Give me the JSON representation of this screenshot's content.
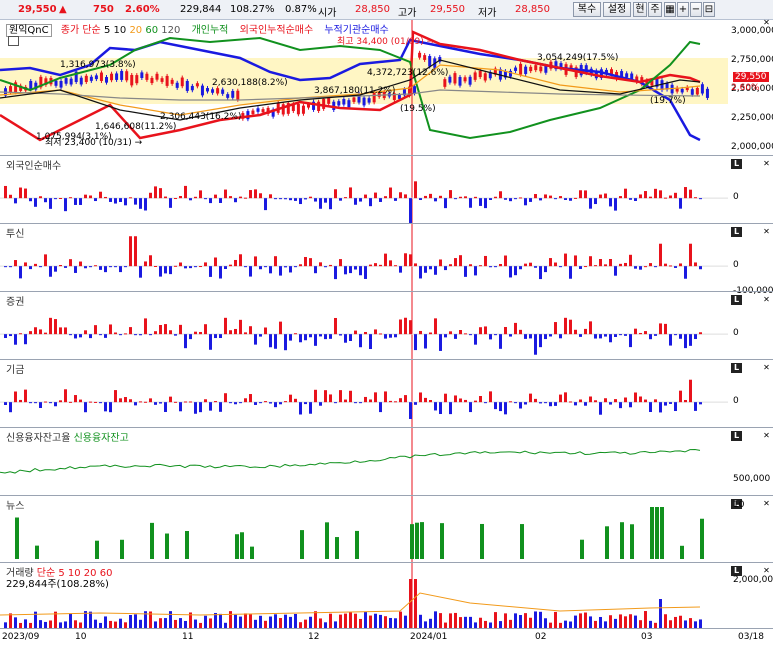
{
  "quote": {
    "price": "29,550",
    "arrow": "▲",
    "change": "750",
    "change_pct": "2.60%",
    "volume": "229,844",
    "vol_ratio": "108.27%",
    "turnover": "0.87%",
    "open_label": "시가",
    "open": "28,850",
    "high_label": "고가",
    "high": "29,550",
    "low_label": "저가",
    "low": "28,850"
  },
  "toolbar": {
    "restore": "복수",
    "settings": "설정",
    "current": "현",
    "week": "주"
  },
  "colors": {
    "red": "#e8131c",
    "blue": "#1a1ae0",
    "green": "#11911e",
    "orange": "#f29a1a",
    "black": "#111111",
    "band": "#fff6c4",
    "gray": "#888888"
  },
  "main_panel": {
    "symbol": "원익QnC",
    "legend": [
      {
        "label": "종가 단순",
        "color": "#e8131c"
      },
      {
        "label": "5",
        "color": "#000000"
      },
      {
        "label": "10",
        "color": "#000000"
      },
      {
        "label": "20",
        "color": "#000000"
      },
      {
        "label": "60",
        "color": "#11911e"
      },
      {
        "label": "120",
        "color": "#000000"
      },
      {
        "label": "개인누적",
        "color": "#11911e"
      },
      {
        "label": "외국인누적순매수",
        "color": "#e8131c"
      },
      {
        "label": "누적기관순매수",
        "color": "#1a1ae0"
      }
    ],
    "y_ticks": [
      "3,000,000",
      "2,750,000",
      "2,500,000",
      "2,250,000",
      "2,000,000"
    ],
    "price_tag": "29,550",
    "pct_tag": "2.60%",
    "annotations": {
      "high": "최고 34,400 (01/09) →",
      "low": "최저 23,400 (10/31) →",
      "v1": "1,316,973(3.8%)",
      "v2": "2,630,188(8.2%)",
      "v3": "4,372,723(12.6%)",
      "v4": "3,867,180(11.2%)",
      "v5": "3,054,249(17.5%)",
      "v6": "2,306,443(16.2%)",
      "v7": "1,646,608(11.2%)",
      "v8": "1,075,994(3.1%)",
      "v9": "(19.5%)",
      "v10": "(19.7%)"
    }
  },
  "panels": [
    {
      "title": "외국인순매수",
      "ticks": [
        "0"
      ]
    },
    {
      "title": "투신",
      "ticks": [
        "0",
        "-100,000"
      ]
    },
    {
      "title": "증권",
      "ticks": [
        "0"
      ]
    },
    {
      "title": "기금",
      "ticks": [
        "0"
      ]
    },
    {
      "title": "신용융자잔고율",
      "title2": "신용융자잔고",
      "ticks": [
        "500,000"
      ]
    },
    {
      "title": "뉴스",
      "ticks": [
        "10"
      ]
    },
    {
      "title": "거래량",
      "legend2": "단순 5 10 20 60",
      "subtitle": "229,844주(108.28%)",
      "ticks": [
        "2,000,000"
      ]
    }
  ],
  "x_axis": [
    "2023/09",
    "10",
    "11",
    "12",
    "2024/01",
    "02",
    "03",
    "03/18"
  ]
}
